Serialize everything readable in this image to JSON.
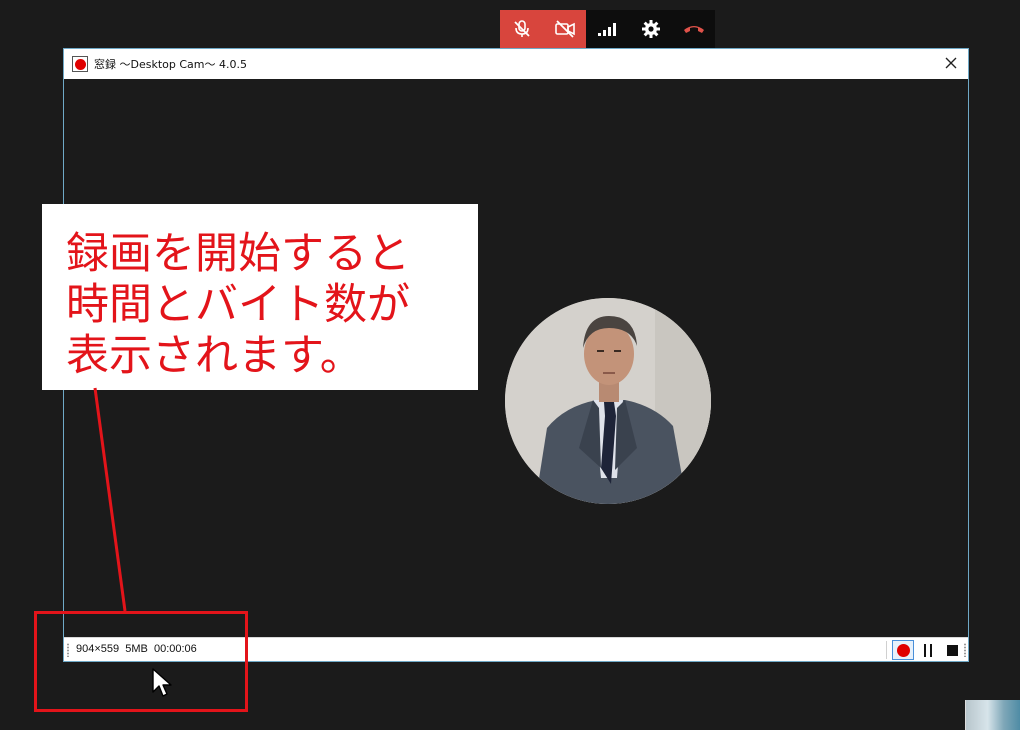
{
  "call_toolbar": {
    "icons": [
      "mic-muted-icon",
      "video-off-icon",
      "signal-strength-icon",
      "settings-gear-icon",
      "hang-up-icon"
    ],
    "colors": {
      "muted_bg": "#d8453d",
      "bar_bg": "#0d0d0d",
      "hangup": "#e0524a"
    }
  },
  "window": {
    "title": "窓録 〜Desktop Cam〜 4.0.5",
    "close_icon": "close-icon"
  },
  "status_bar": {
    "text": "904×559  5MB  00:00:06",
    "record_icon": "record-icon",
    "pause_icon": "pause-icon",
    "stop_icon": "stop-icon"
  },
  "annotation": {
    "text": "録画を開始すると\n時間とバイト数が\n表示されます。",
    "color": "#e3141a"
  }
}
